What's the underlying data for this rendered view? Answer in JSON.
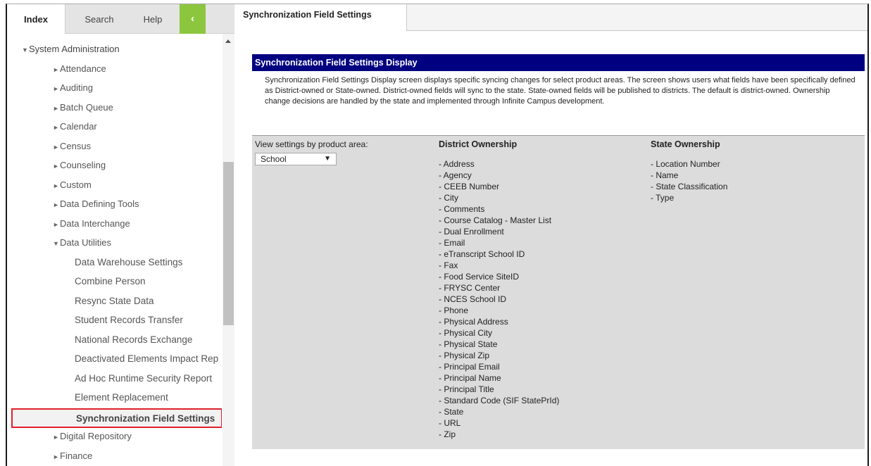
{
  "sidebar": {
    "tabs": {
      "index": "Index",
      "search": "Search",
      "help": "Help",
      "collapse": "‹"
    },
    "tree": [
      {
        "label": "System Administration",
        "level": 0,
        "expanded": true
      },
      {
        "label": "Attendance",
        "level": 1,
        "expanded": false
      },
      {
        "label": "Auditing",
        "level": 1,
        "expanded": false
      },
      {
        "label": "Batch Queue",
        "level": 1,
        "expanded": false
      },
      {
        "label": "Calendar",
        "level": 1,
        "expanded": false
      },
      {
        "label": "Census",
        "level": 1,
        "expanded": false
      },
      {
        "label": "Counseling",
        "level": 1,
        "expanded": false
      },
      {
        "label": "Custom",
        "level": 1,
        "expanded": false
      },
      {
        "label": "Data Defining Tools",
        "level": 1,
        "expanded": false
      },
      {
        "label": "Data Interchange",
        "level": 1,
        "expanded": false
      },
      {
        "label": "Data Utilities",
        "level": 1,
        "expanded": true
      },
      {
        "label": "Data Warehouse Settings",
        "level": 2
      },
      {
        "label": "Combine Person",
        "level": 2
      },
      {
        "label": "Resync State Data",
        "level": 2
      },
      {
        "label": "Student Records Transfer",
        "level": 2
      },
      {
        "label": "National Records Exchange",
        "level": 2
      },
      {
        "label": "Deactivated Elements Impact Rep",
        "level": 2
      },
      {
        "label": "Ad Hoc Runtime Security Report",
        "level": 2
      },
      {
        "label": "Element Replacement",
        "level": 2
      },
      {
        "label": "Synchronization Field Settings",
        "level": 2,
        "selected": true
      },
      {
        "label": "Digital Repository",
        "level": 1,
        "expanded": false
      },
      {
        "label": "Finance",
        "level": 1,
        "expanded": false
      }
    ]
  },
  "main": {
    "tab_title": "Synchronization Field Settings",
    "section_title": "Synchronization Field Settings Display",
    "description": "Synchronization Field Settings Display screen displays specific syncing changes for select product areas. The screen shows users what fields have been specifically defined as District-owned or State-owned. District-owned fields will sync to the state. State-owned fields will be published to districts. The default is district-owned. Ownership change decisions are handled by the state and implemented through Infinite Campus development.",
    "view_label": "View settings by product area:",
    "product_area": "School",
    "district_heading": "District Ownership",
    "state_heading": "State Ownership",
    "district_fields": [
      "- Address",
      "- Agency",
      "- CEEB Number",
      "- City",
      "- Comments",
      "- Course Catalog - Master List",
      "- Dual Enrollment",
      "- Email",
      "- eTranscript School ID",
      "- Fax",
      "- Food Service SiteID",
      "- FRYSC Center",
      "- NCES School ID",
      "- Phone",
      "- Physical Address",
      "- Physical City",
      "- Physical State",
      "- Physical Zip",
      "- Principal Email",
      "- Principal Name",
      "- Principal Title",
      "- Standard Code (SIF StatePrId)",
      "- State",
      "- URL",
      "- Zip"
    ],
    "state_fields": [
      "- Location Number",
      "- Name",
      "- State Classification",
      "- Type"
    ]
  },
  "colors": {
    "header_navy": "#000080",
    "collapse_green": "#8cc63f",
    "highlight_red": "#e0202a",
    "panel_gray": "#dcdcdc"
  }
}
